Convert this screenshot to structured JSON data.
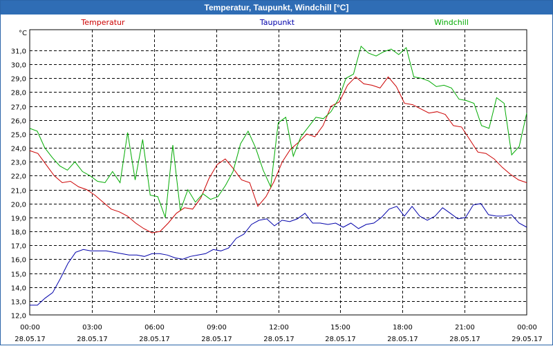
{
  "window": {
    "title": "Temperatur, Taupunkt, Windchill [°C]"
  },
  "chart_data": {
    "type": "line",
    "title": "Temperatur, Taupunkt, Windchill [°C]",
    "ylabel": "°C",
    "xlabel": "",
    "ylim": [
      12.0,
      31.0
    ],
    "xlim": [
      0,
      24
    ],
    "grid": true,
    "y_ticks": [
      "12,0",
      "13,0",
      "14,0",
      "15,0",
      "16,0",
      "17,0",
      "18,0",
      "19,0",
      "20,0",
      "21,0",
      "22,0",
      "23,0",
      "24,0",
      "25,0",
      "26,0",
      "27,0",
      "28,0",
      "29,0",
      "30,0",
      "31,0"
    ],
    "x_ticks": [
      {
        "x": 0,
        "time": "00:00",
        "date": "28.05.17"
      },
      {
        "x": 3,
        "time": "03:00",
        "date": "28.05.17"
      },
      {
        "x": 6,
        "time": "06:00",
        "date": "28.05.17"
      },
      {
        "x": 9,
        "time": "09:00",
        "date": "28.05.17"
      },
      {
        "x": 12,
        "time": "12:00",
        "date": "28.05.17"
      },
      {
        "x": 15,
        "time": "15:00",
        "date": "28.05.17"
      },
      {
        "x": 18,
        "time": "18:00",
        "date": "28.05.17"
      },
      {
        "x": 21,
        "time": "21:00",
        "date": "28.05.17"
      },
      {
        "x": 24,
        "time": "00:00",
        "date": "29.05.17"
      }
    ],
    "x": [
      0,
      0.5,
      1,
      1.5,
      2,
      2.5,
      3,
      3.5,
      4,
      4.5,
      5,
      5.5,
      6,
      6.5,
      7,
      7.5,
      8,
      8.5,
      9,
      9.5,
      10,
      10.5,
      11,
      11.5,
      12,
      12.5,
      13,
      13.5,
      14,
      14.5,
      15,
      15.5,
      16,
      16.5,
      17,
      17.5,
      18,
      18.5,
      19,
      19.5,
      20,
      20.5,
      21,
      21.5,
      22,
      22.5,
      23,
      23.5,
      24
    ],
    "series": [
      {
        "name": "Temperatur",
        "color": "#cc0000",
        "values": [
          23.8,
          23.6,
          22.8,
          22.0,
          21.5,
          21.6,
          21.2,
          21.0,
          20.6,
          20.1,
          19.6,
          19.4,
          19.1,
          18.6,
          18.2,
          17.9,
          18.0,
          18.6,
          19.3,
          19.7,
          19.6,
          20.4,
          21.8,
          22.8,
          23.2,
          22.5,
          21.7,
          21.5,
          19.8,
          20.5,
          21.6,
          23.0,
          23.9,
          24.4,
          25.0,
          24.8,
          25.6,
          27.0,
          27.3,
          28.5,
          29.1,
          28.6,
          28.5,
          28.3,
          29.1,
          28.4,
          27.2,
          27.1,
          26.8,
          26.5,
          26.6,
          26.4,
          25.6,
          25.5,
          24.6,
          23.7,
          23.6,
          23.2,
          22.6,
          22.1,
          21.7,
          21.5
        ]
      },
      {
        "name": "Taupunkt",
        "color": "#0000aa",
        "values": [
          12.7,
          12.7,
          13.2,
          13.6,
          14.6,
          15.7,
          16.5,
          16.7,
          16.6,
          16.6,
          16.6,
          16.5,
          16.4,
          16.3,
          16.3,
          16.2,
          16.4,
          16.4,
          16.3,
          16.1,
          16.0,
          16.2,
          16.3,
          16.4,
          16.7,
          16.6,
          16.8,
          17.5,
          17.8,
          18.5,
          18.8,
          18.9,
          18.4,
          18.8,
          18.7,
          18.9,
          19.3,
          18.6,
          18.6,
          18.5,
          18.6,
          18.3,
          18.6,
          18.2,
          18.5,
          18.6,
          19.0,
          19.6,
          19.8,
          19.1,
          19.8,
          19.1,
          18.8,
          19.1,
          19.7,
          19.3,
          18.9,
          19.0,
          19.9,
          20.0,
          19.2,
          19.1,
          19.1,
          19.2,
          18.6,
          18.3
        ]
      },
      {
        "name": "Windchill",
        "color": "#00aa00",
        "values": [
          25.4,
          25.2,
          24.0,
          23.3,
          22.7,
          22.4,
          23.0,
          22.3,
          22.0,
          21.6,
          21.5,
          22.3,
          21.5,
          25.1,
          21.7,
          24.6,
          20.6,
          20.5,
          19.0,
          24.2,
          19.5,
          21.0,
          20.1,
          20.7,
          20.3,
          20.5,
          21.3,
          22.3,
          24.3,
          25.2,
          24.0,
          22.4,
          21.2,
          25.8,
          26.2,
          23.4,
          24.8,
          25.5,
          26.2,
          26.1,
          26.6,
          27.5,
          29.0,
          29.3,
          31.3,
          30.8,
          30.6,
          30.9,
          31.1,
          30.7,
          31.2,
          29.1,
          29.0,
          28.8,
          28.4,
          28.5,
          28.3,
          27.5,
          27.4,
          27.2,
          25.6,
          25.4,
          27.6,
          27.2,
          23.5,
          24.1,
          26.5
        ]
      }
    ]
  }
}
